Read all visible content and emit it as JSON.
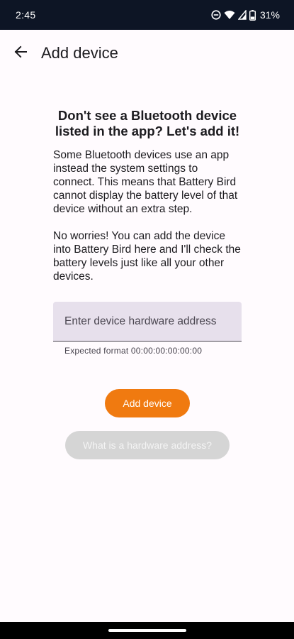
{
  "status_bar": {
    "time": "2:45",
    "battery_percent": "31%",
    "icons": [
      "do-not-disturb-icon",
      "wifi-icon",
      "signal-icon",
      "battery-icon"
    ]
  },
  "app_bar": {
    "title": "Add device",
    "back_icon": "arrow-back-icon"
  },
  "main": {
    "headline": "Don't see a Bluetooth device listed in the app? Let's add it!",
    "paragraph1": "Some Bluetooth devices use an app instead the system settings to connect. This means that Battery Bird cannot display the battery level of that device without an extra step.",
    "paragraph2": "No worries! You can add the device into Battery Bird here and I'll check the battery levels just like all your other devices."
  },
  "address_field": {
    "placeholder": "Enter device hardware address",
    "value": "",
    "helper": "Expected format 00:00:00:00:00:00"
  },
  "buttons": {
    "add_device": "Add device",
    "what_is_address": "What is a hardware address?"
  },
  "colors": {
    "accent": "#f07a10",
    "status_bar_bg": "#0d1525",
    "field_bg": "#e7e0ec",
    "disabled_bg": "#d5d5d5"
  }
}
